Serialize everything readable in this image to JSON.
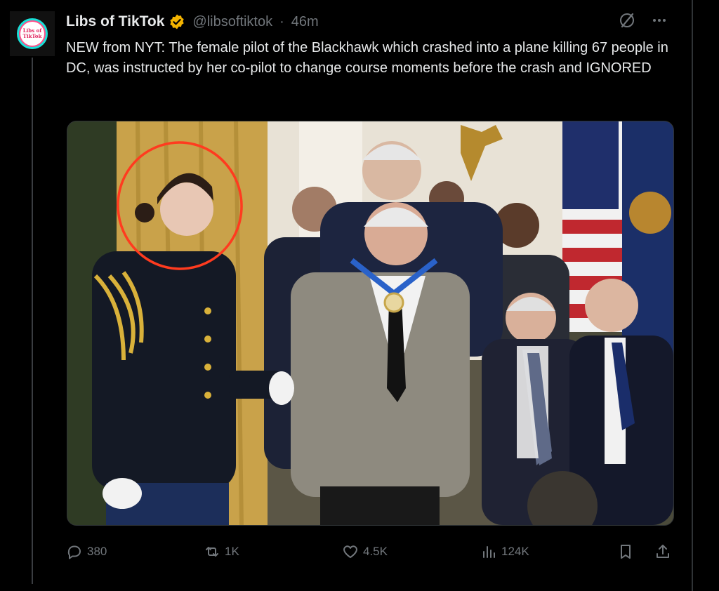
{
  "post": {
    "author_name": "Libs of TikTok",
    "handle": "@libsoftiktok",
    "separator": "·",
    "time": "46m",
    "avatar_text_line1": "Libs of",
    "avatar_text_line2": "TikTok",
    "text": "NEW from NYT: The female pilot of the Blackhawk which crashed into a plane killing 67 people in DC, was instructed by her co-pilot to change course moments before the crash and IGNORED"
  },
  "icons": {
    "verified": "verified-badge-icon",
    "grok": "grok-icon",
    "more": "more-icon",
    "reply": "reply-icon",
    "repost": "repost-icon",
    "like": "like-icon",
    "views": "views-icon",
    "bookmark": "bookmark-icon",
    "share": "share-icon"
  },
  "colors": {
    "background": "#000000",
    "text": "#e7e9ea",
    "muted": "#71767b",
    "verified": "#f4b400",
    "annotation_circle": "#ff3b1f"
  },
  "actions": {
    "replies": "380",
    "reposts": "1K",
    "likes": "4.5K",
    "views": "124K"
  }
}
